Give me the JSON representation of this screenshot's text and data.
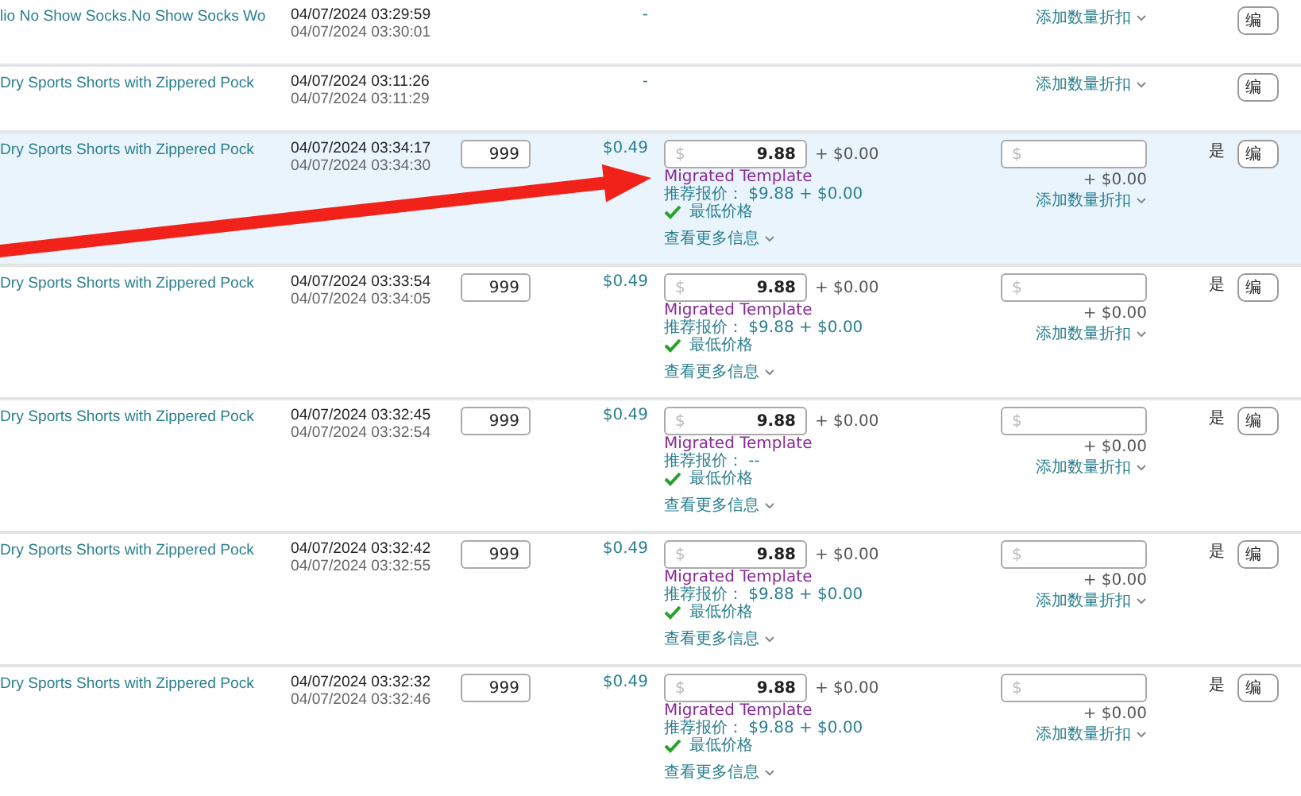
{
  "rows": [
    {
      "kind": "basic",
      "selected": false,
      "title": "lio No Show Socks.No Show Socks Wo",
      "created": "04/07/2024 03:29:59",
      "updated": "04/07/2024 03:30:01",
      "unit_price": "-",
      "discount_link": "添加数量折扣",
      "edit": "编"
    },
    {
      "kind": "basic",
      "selected": false,
      "title": "Dry Sports Shorts with Zippered Pock",
      "created": "04/07/2024 03:11:26",
      "updated": "04/07/2024 03:11:29",
      "unit_price": "-",
      "discount_link": "添加数量折扣",
      "edit": "编"
    },
    {
      "kind": "full",
      "selected": true,
      "title": "Dry Sports Shorts with Zippered Pock",
      "created": "04/07/2024 03:34:17",
      "updated": "04/07/2024 03:34:30",
      "quantity": "999",
      "unit_price": "$0.49",
      "currency": "$",
      "price": "9.88",
      "shipping": "+ $0.00",
      "template": "Migrated Template",
      "recommended": "推荐报价： $9.88 + $0.00",
      "lowest": {
        "checked": true,
        "label": "最低价格"
      },
      "more": "查看更多信息",
      "discount_currency": "$",
      "discount_shipping": "+ $0.00",
      "discount_link": "添加数量折扣",
      "flag": "是",
      "edit": "编"
    },
    {
      "kind": "full",
      "selected": false,
      "title": "Dry Sports Shorts with Zippered Pock",
      "created": "04/07/2024 03:33:54",
      "updated": "04/07/2024 03:34:05",
      "quantity": "999",
      "unit_price": "$0.49",
      "currency": "$",
      "price": "9.88",
      "shipping": "+ $0.00",
      "template": "Migrated Template",
      "recommended": "推荐报价： $9.88 + $0.00",
      "lowest": {
        "checked": true,
        "label": "最低价格"
      },
      "more": "查看更多信息",
      "discount_currency": "$",
      "discount_shipping": "+ $0.00",
      "discount_link": "添加数量折扣",
      "flag": "是",
      "edit": "编"
    },
    {
      "kind": "full",
      "selected": false,
      "title": "Dry Sports Shorts with Zippered Pock",
      "created": "04/07/2024 03:32:45",
      "updated": "04/07/2024 03:32:54",
      "quantity": "999",
      "unit_price": "$0.49",
      "currency": "$",
      "price": "9.88",
      "shipping": "+ $0.00",
      "template": "Migrated Template",
      "recommended": "推荐报价： --",
      "lowest": {
        "checked": true,
        "label": "最低价格"
      },
      "more": "查看更多信息",
      "discount_currency": "$",
      "discount_shipping": "+ $0.00",
      "discount_link": "添加数量折扣",
      "flag": "是",
      "edit": "编"
    },
    {
      "kind": "full",
      "selected": false,
      "title": "Dry Sports Shorts with Zippered Pock",
      "created": "04/07/2024 03:32:42",
      "updated": "04/07/2024 03:32:55",
      "quantity": "999",
      "unit_price": "$0.49",
      "currency": "$",
      "price": "9.88",
      "shipping": "+ $0.00",
      "template": "Migrated Template",
      "recommended": "推荐报价： $9.88 + $0.00",
      "lowest": {
        "checked": true,
        "label": "最低价格"
      },
      "more": "查看更多信息",
      "discount_currency": "$",
      "discount_shipping": "+ $0.00",
      "discount_link": "添加数量折扣",
      "flag": "是",
      "edit": "编"
    },
    {
      "kind": "full",
      "selected": false,
      "title": "Dry Sports Shorts with Zippered Pock",
      "created": "04/07/2024 03:32:32",
      "updated": "04/07/2024 03:32:46",
      "quantity": "999",
      "unit_price": "$0.49",
      "currency": "$",
      "price": "9.88",
      "shipping": "+ $0.00",
      "template": "Migrated Template",
      "recommended": "推荐报价： $9.88 + $0.00",
      "lowest": {
        "checked": true,
        "label": "最低价格"
      },
      "more": "查看更多信息",
      "discount_currency": "$",
      "discount_shipping": "+ $0.00",
      "discount_link": "添加数量折扣",
      "flag": "是",
      "edit": "编"
    }
  ]
}
